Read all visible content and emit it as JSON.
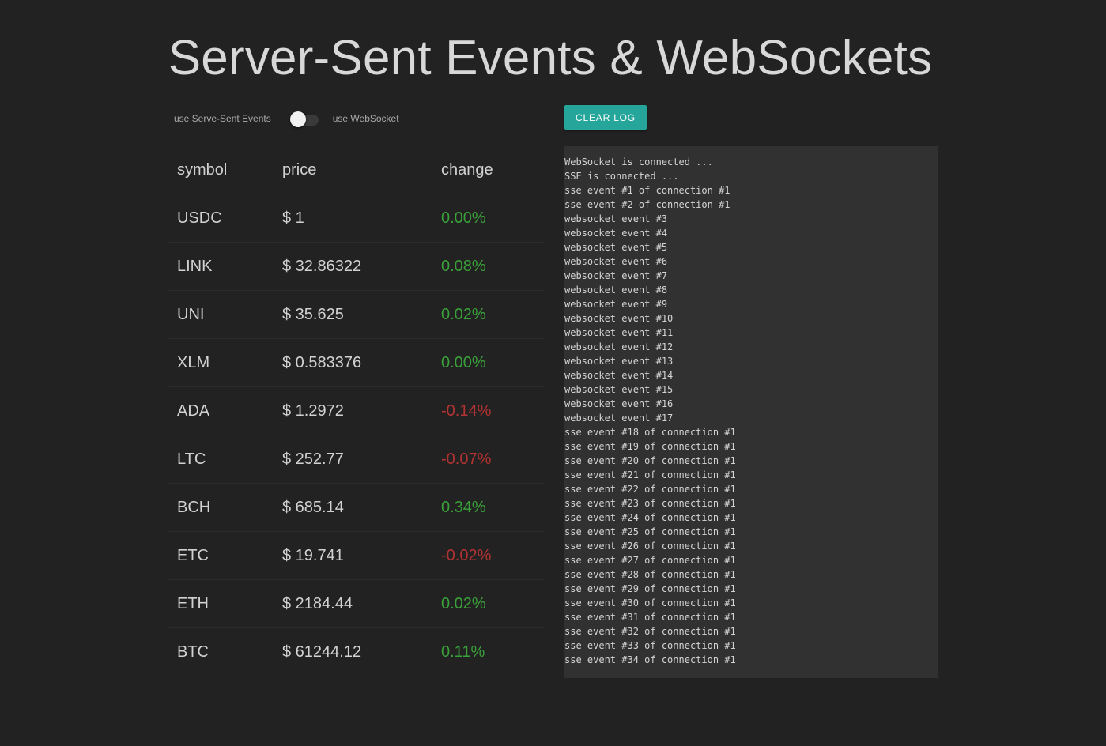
{
  "page": {
    "title": "Server-Sent Events & WebSockets"
  },
  "toggle": {
    "left_label": "use Serve-Sent Events",
    "right_label": "use WebSocket",
    "state": "off"
  },
  "table": {
    "headers": {
      "symbol": "symbol",
      "price": "price",
      "change": "change"
    },
    "rows": [
      {
        "symbol": "USDC",
        "price": "$ 1",
        "change": "0.00%",
        "direction": "pos"
      },
      {
        "symbol": "LINK",
        "price": "$ 32.86322",
        "change": "0.08%",
        "direction": "pos"
      },
      {
        "symbol": "UNI",
        "price": "$ 35.625",
        "change": "0.02%",
        "direction": "pos"
      },
      {
        "symbol": "XLM",
        "price": "$ 0.583376",
        "change": "0.00%",
        "direction": "pos"
      },
      {
        "symbol": "ADA",
        "price": "$ 1.2972",
        "change": "-0.14%",
        "direction": "neg"
      },
      {
        "symbol": "LTC",
        "price": "$ 252.77",
        "change": "-0.07%",
        "direction": "neg"
      },
      {
        "symbol": "BCH",
        "price": "$ 685.14",
        "change": "0.34%",
        "direction": "pos"
      },
      {
        "symbol": "ETC",
        "price": "$ 19.741",
        "change": "-0.02%",
        "direction": "neg"
      },
      {
        "symbol": "ETH",
        "price": "$ 2184.44",
        "change": "0.02%",
        "direction": "pos"
      },
      {
        "symbol": "BTC",
        "price": "$ 61244.12",
        "change": "0.11%",
        "direction": "pos"
      }
    ]
  },
  "log": {
    "clear_label": "CLEAR LOG",
    "lines": [
      "WebSocket is connected ...",
      "SSE is connected ...",
      "sse event #1 of connection #1",
      "sse event #2 of connection #1",
      "websocket event #3",
      "websocket event #4",
      "websocket event #5",
      "websocket event #6",
      "websocket event #7",
      "websocket event #8",
      "websocket event #9",
      "websocket event #10",
      "websocket event #11",
      "websocket event #12",
      "websocket event #13",
      "websocket event #14",
      "websocket event #15",
      "websocket event #16",
      "websocket event #17",
      "sse event #18 of connection #1",
      "sse event #19 of connection #1",
      "sse event #20 of connection #1",
      "sse event #21 of connection #1",
      "sse event #22 of connection #1",
      "sse event #23 of connection #1",
      "sse event #24 of connection #1",
      "sse event #25 of connection #1",
      "sse event #26 of connection #1",
      "sse event #27 of connection #1",
      "sse event #28 of connection #1",
      "sse event #29 of connection #1",
      "sse event #30 of connection #1",
      "sse event #31 of connection #1",
      "sse event #32 of connection #1",
      "sse event #33 of connection #1",
      "sse event #34 of connection #1"
    ]
  },
  "colors": {
    "background": "#222222",
    "accent": "#26a69a",
    "positive": "#3aa13a",
    "negative": "#b33232",
    "log_background": "#313131"
  }
}
